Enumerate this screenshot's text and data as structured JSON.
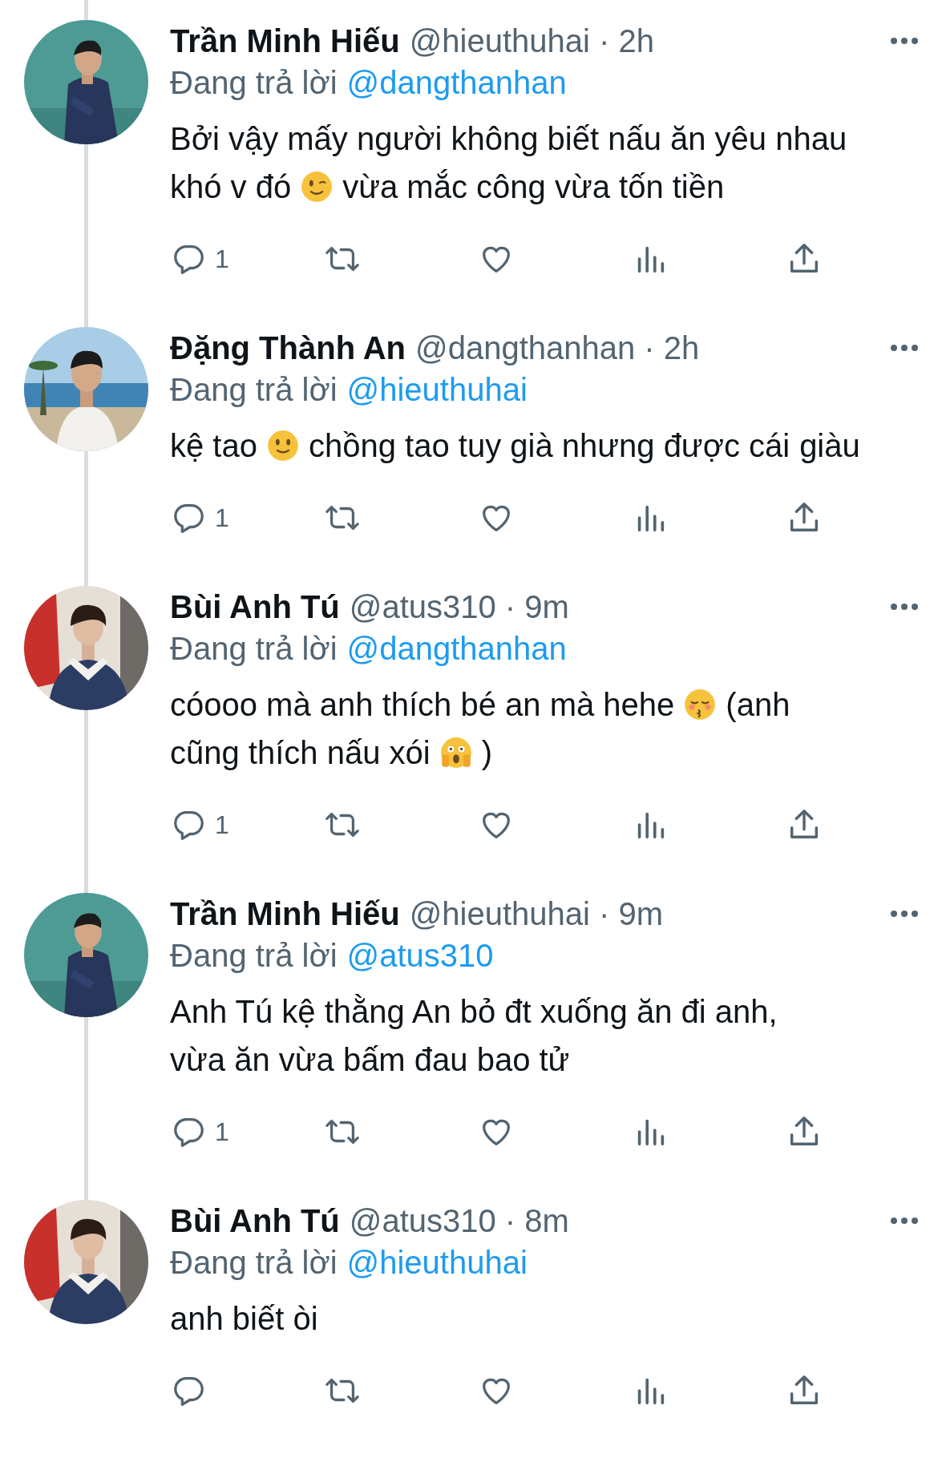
{
  "tweets": [
    {
      "author": "Trần Minh Hiếu",
      "handle_time": "@hieuthuhai · 2h",
      "reply_label": "Đang trả lời",
      "reply_to": "@dangthanhan",
      "body": [
        {
          "kind": "text",
          "text": "Bởi vậy mấy người không biết nấu ăn yêu nhau"
        },
        {
          "kind": "text",
          "text": "khó v đó"
        },
        {
          "kind": "wink"
        },
        {
          "kind": "text",
          "text": "vừa mắc công vừa tốn tiền"
        }
      ],
      "reply_count": "1"
    },
    {
      "author": "Đặng Thành An",
      "handle_time": "@dangthanhan · 2h",
      "reply_label": "Đang trả lời",
      "reply_to": "@hieuthuhai",
      "body": [
        {
          "kind": "text",
          "text": "kệ tao"
        },
        {
          "kind": "smile"
        },
        {
          "kind": "text",
          "text": "chồng tao tuy già nhưng được cái"
        },
        {
          "kind": "text",
          "text": "giàu"
        }
      ],
      "reply_count": "1"
    },
    {
      "author": "Bùi Anh Tú",
      "handle_time": "@atus310 · 9m",
      "reply_label": "Đang trả lời",
      "reply_to": "@dangthanhan",
      "body": [
        {
          "kind": "text",
          "text": "cóooo mà anh thích bé an mà hehe"
        },
        {
          "kind": "kiss"
        },
        {
          "kind": "text",
          "text": "(anh"
        },
        {
          "kind": "text",
          "text": "cũng thích nấu xói"
        },
        {
          "kind": "shock"
        },
        {
          "kind": "text",
          "text": ")"
        }
      ],
      "reply_count": "1"
    },
    {
      "author": "Trần Minh Hiếu",
      "handle_time": "@hieuthuhai · 9m",
      "reply_label": "Đang trả lời",
      "reply_to": "@atus310",
      "body": [
        {
          "kind": "text",
          "text": "Anh Tú kệ thằng An bỏ đt xuống ăn đi anh,"
        },
        {
          "kind": "text",
          "text": "vừa ăn vừa bấm đau bao tử"
        }
      ],
      "reply_count": "1"
    },
    {
      "author": "Bùi Anh Tú",
      "handle_time": "@atus310 · 8m",
      "reply_label": "Đang trả lời",
      "reply_to": "@hieuthuhai",
      "body": [
        {
          "kind": "text",
          "text": "anh biết òi"
        }
      ]
    }
  ]
}
